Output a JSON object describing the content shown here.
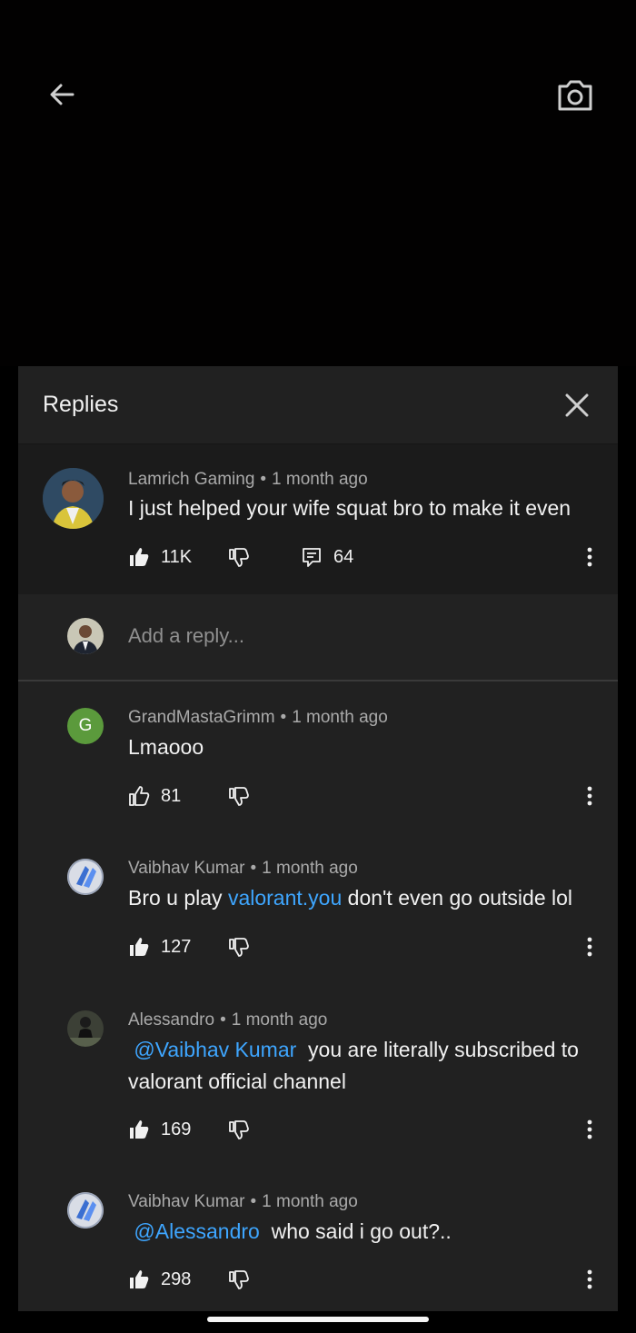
{
  "icons": {
    "back": "arrow-left-icon",
    "camera": "camera-icon",
    "close": "close-icon",
    "like": "thumbs-up-icon",
    "dislike": "thumbs-down-icon",
    "reply": "reply-comment-icon",
    "more": "more-vertical-icon"
  },
  "colors": {
    "panel_bg": "#212121",
    "text": "#f1f1f1",
    "meta_text": "#aaaaaa",
    "link": "#3ea6ff",
    "avatar_g": "#5b9a3c"
  },
  "panel": {
    "title": "Replies"
  },
  "parent_comment": {
    "author": "Lamrich Gaming",
    "separator": "•",
    "time": "1 month ago",
    "text": "I just helped your wife squat bro to make it even",
    "likes": "11K",
    "replies": "64"
  },
  "reply_input": {
    "placeholder": "Add a reply..."
  },
  "replies": [
    {
      "author": "GrandMastaGrimm",
      "separator": "•",
      "time": "1 month ago",
      "avatar_letter": "G",
      "text": "Lmaooo",
      "likes": "81"
    },
    {
      "author": "Vaibhav Kumar",
      "separator": "•",
      "time": "1 month ago",
      "text_before": "Bro u play ",
      "link": "valorant.you",
      "text_after": " don't even go outside lol",
      "likes": "127"
    },
    {
      "author": "Alessandro",
      "separator": "•",
      "time": "1 month ago",
      "mention": "@Vaibhav Kumar",
      "text": "  you are literally subscribed to valorant official channel",
      "likes": "169"
    },
    {
      "author": "Vaibhav Kumar",
      "separator": "•",
      "time": "1 month ago",
      "mention": "@Alessandro",
      "text": "  who said i go out?..",
      "likes": "298"
    }
  ]
}
